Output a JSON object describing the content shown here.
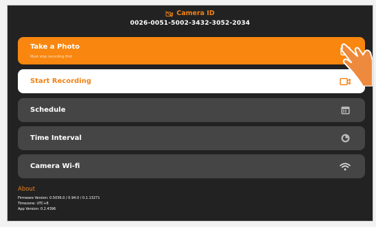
{
  "colors": {
    "accent": "#f08216",
    "background": "#222222",
    "row_dark": "#454545",
    "row_white": "#ffffff"
  },
  "header": {
    "title": "Camera ID",
    "camera_id": "0026-0051-5002-3432-3052-2034",
    "title_icon": "camera-off-icon"
  },
  "menu": {
    "take_photo": {
      "label": "Take a Photo",
      "sublabel": "Must stop recording first",
      "icon": "image-icon"
    },
    "start_recording": {
      "label": "Start Recording",
      "icon": "video-camera-icon"
    },
    "schedule": {
      "label": "Schedule",
      "icon": "calendar-icon"
    },
    "time_interval": {
      "label": "Time Interval",
      "icon": "timer-icon"
    },
    "camera_wifi": {
      "label": "Camera Wi-fi",
      "icon": "wifi-icon"
    }
  },
  "about": {
    "title": "About",
    "firmware": "Firmware Version: 0.5036.0 / 0.94.0 / 0.1.13271",
    "timezone": "Timezone: UTC+8",
    "app_version": "App Version: 0.2.4396"
  }
}
